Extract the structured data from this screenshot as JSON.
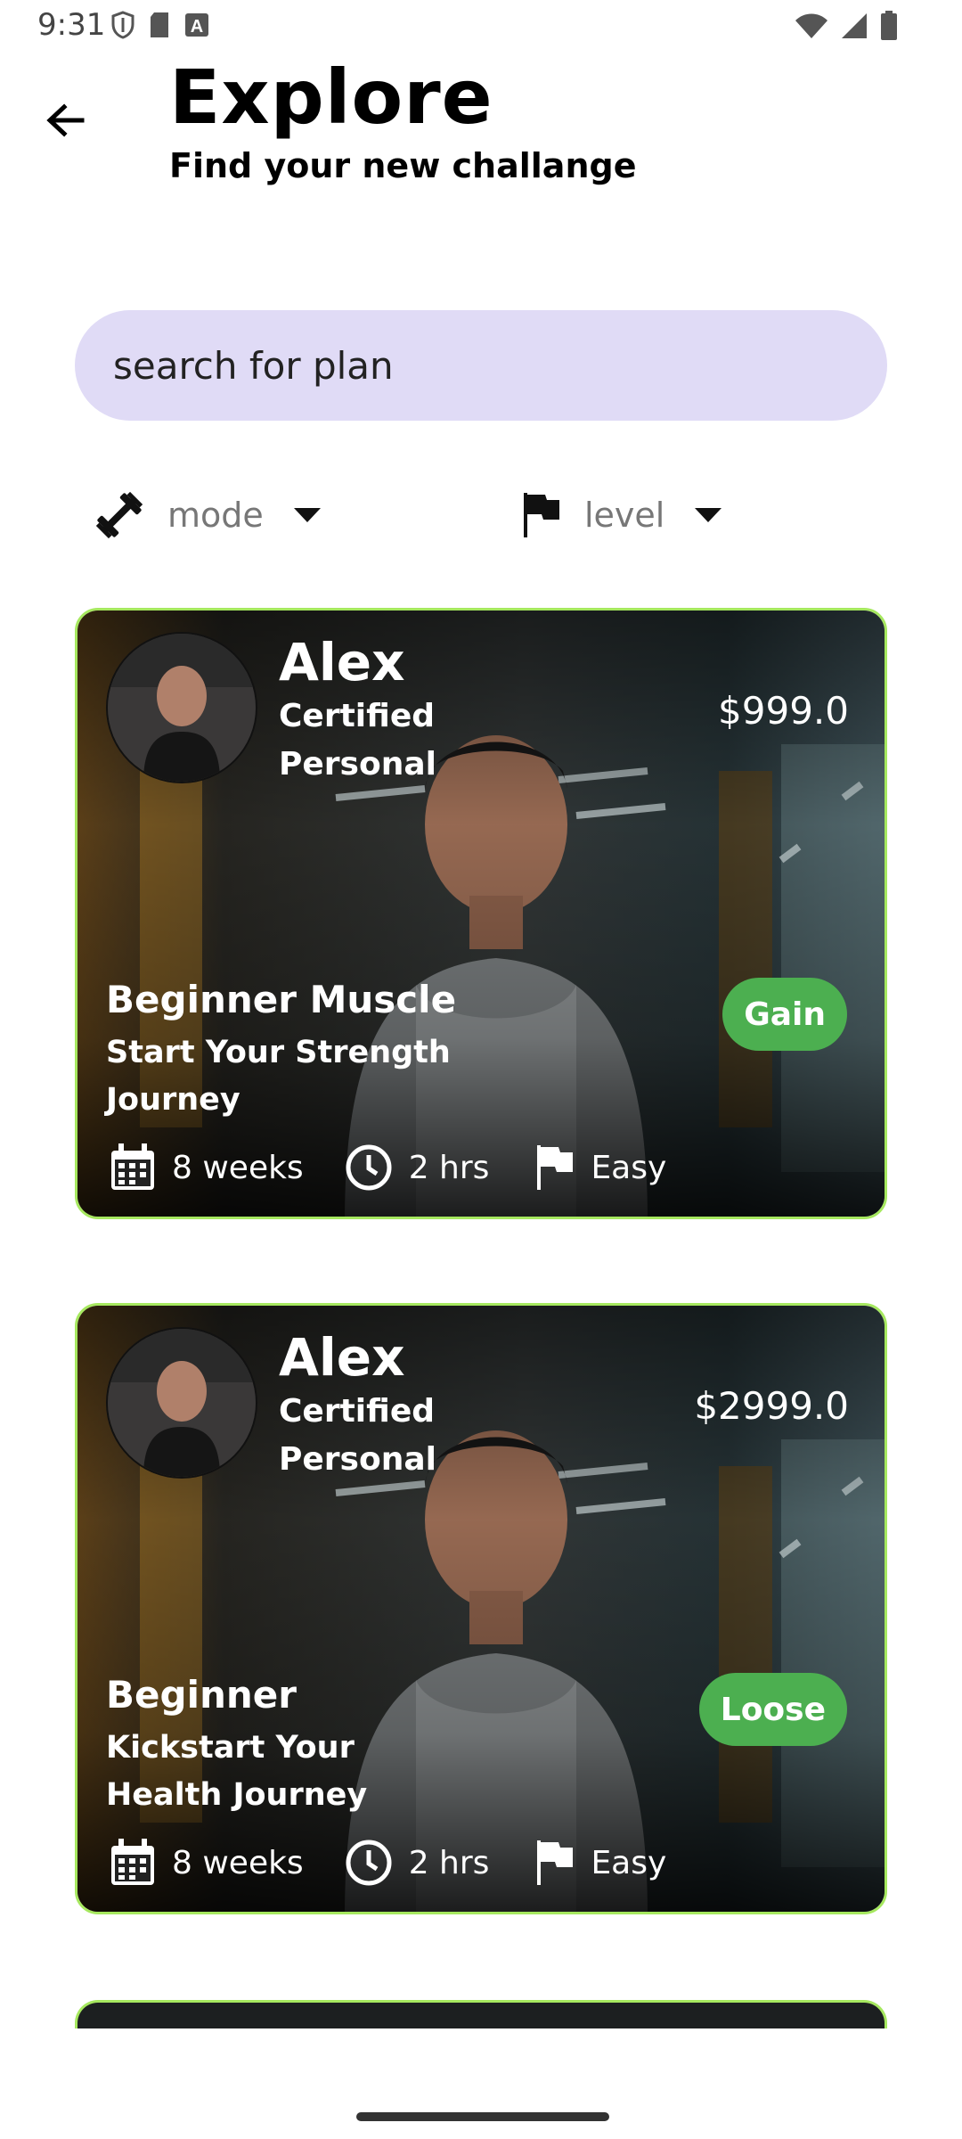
{
  "status_bar": {
    "time": "9:31"
  },
  "header": {
    "title": "Explore",
    "subtitle": "Find your new challange"
  },
  "search": {
    "placeholder": "search for plan"
  },
  "filters": {
    "mode_label": "mode",
    "level_label": "level"
  },
  "plans": [
    {
      "trainer_name": "Alex",
      "trainer_title": "Certified Personal",
      "price": "$999.0",
      "plan_name": "Beginner Muscle",
      "plan_desc": "Start Your Strength Journey",
      "goal": "Gain",
      "duration": "8 weeks",
      "time": "2 hrs",
      "level": "Easy"
    },
    {
      "trainer_name": "Alex",
      "trainer_title": "Certified Personal",
      "price": "$2999.0",
      "plan_name": "Beginner",
      "plan_desc": "Kickstart Your Health Journey",
      "goal": "Loose",
      "duration": "8 weeks",
      "time": "2 hrs",
      "level": "Easy"
    }
  ],
  "colors": {
    "accent_border": "#a6e85f",
    "badge_green": "#4caf50",
    "search_bg": "#e0dbf6"
  }
}
